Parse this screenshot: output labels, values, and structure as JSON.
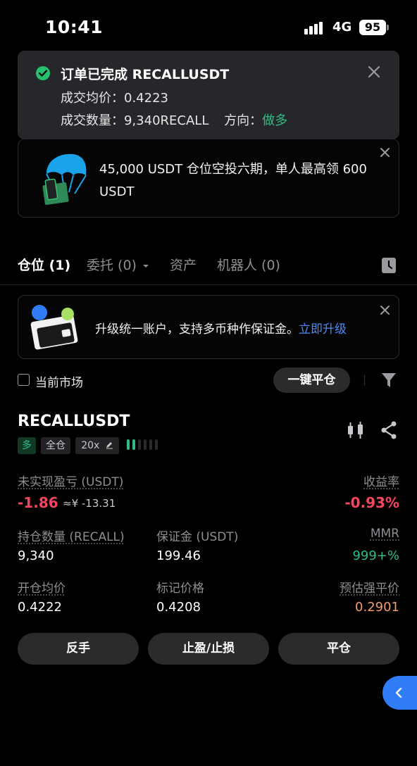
{
  "status_bar": {
    "time": "10:41",
    "network": "4G",
    "battery": "95"
  },
  "toast": {
    "title": "订单已完成 RECALLUSDT",
    "avg_price_label": "成交均价：",
    "avg_price": "0.4223",
    "qty_label": "成交数量：",
    "qty": "9,340RECALL",
    "direction_label": "方向：",
    "direction": "做多",
    "colors": {
      "success": "#27c06f",
      "long": "#2ebd85"
    }
  },
  "airdrop_banner": {
    "text": "45,000 USDT 仓位空投六期，单人最高领 600 USDT"
  },
  "tabs": [
    {
      "label": "仓位 (1)",
      "active": true
    },
    {
      "label": "委托 (0)",
      "active": false,
      "has_dropdown": true
    },
    {
      "label": "资产",
      "active": false
    },
    {
      "label": "机器人 (0)",
      "active": false
    }
  ],
  "upgrade_banner": {
    "text": "升级统一账户，支持多币种作保证金。",
    "link": "立即升级",
    "link_color": "#4e8af5"
  },
  "filter": {
    "current_market": "当前市场",
    "close_all": "一键平仓"
  },
  "position": {
    "symbol": "RECALLUSDT",
    "side_tag": "多",
    "margin_mode": "全仓",
    "leverage": "20x",
    "unrealized_label": "未实现盈亏 (USDT)",
    "unrealized_pnl": "-1.86",
    "unrealized_cny": "≈¥ -13.31",
    "roi_label": "收益率",
    "roi": "-0.93%",
    "size_label": "持仓数量 (RECALL)",
    "size": "9,340",
    "margin_label": "保证金 (USDT)",
    "margin": "199.46",
    "mmr_label": "MMR",
    "mmr": "999+%",
    "entry_label": "开仓均价",
    "entry": "0.4222",
    "mark_label": "标记价格",
    "mark": "0.4208",
    "liq_label": "预估强平价",
    "liq": "0.2901",
    "colors": {
      "loss": "#f6465d",
      "profit": "#2ebd85",
      "liq": "#f59b6e"
    }
  },
  "actions": {
    "reverse": "反手",
    "tpsl": "止盈/止损",
    "close": "平仓"
  },
  "icons": [
    "check-circle-icon",
    "close-icon",
    "parachute-icon",
    "history-icon",
    "wallet-icon",
    "filter-icon",
    "kline-icon",
    "share-icon",
    "edit-icon",
    "chevron-left-icon"
  ]
}
